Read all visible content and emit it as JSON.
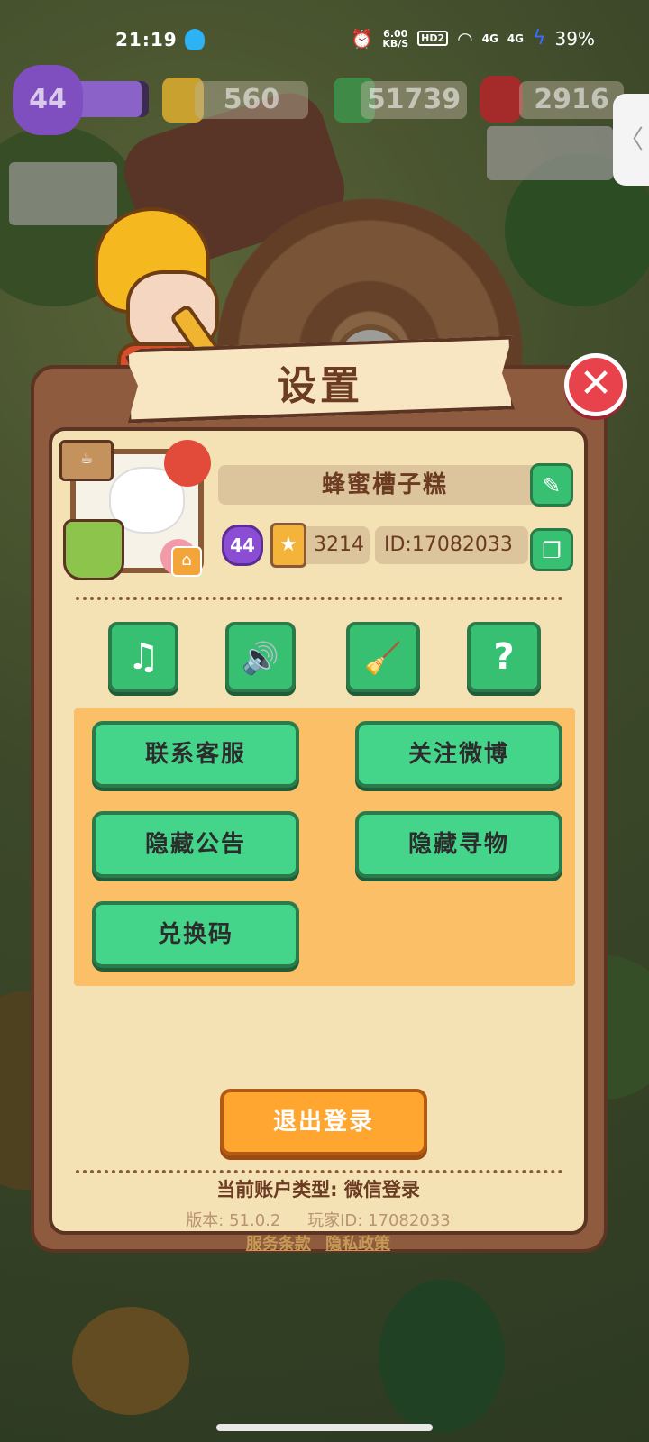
{
  "status_bar": {
    "time": "21:19",
    "net_speed": "6.00",
    "net_unit": "KB/S",
    "hd": "HD2",
    "sig1": "4G",
    "sig2": "4G",
    "battery": "39%"
  },
  "resources": {
    "level": "44",
    "xp_fraction": 0.9,
    "energy": "560",
    "cash": "51739",
    "gems": "2916"
  },
  "side_tab": {
    "glyph": "〈"
  },
  "dialog": {
    "title": "设置",
    "close": "✕",
    "profile": {
      "nickname": "蜂蜜槽子糕",
      "level": "44",
      "stars": "3214",
      "player_id": "ID:17082033",
      "edit_glyph": "✎",
      "copy_glyph": "❐"
    },
    "icon_buttons": {
      "music": "♫",
      "sound": "🔊",
      "clean": "🧹",
      "help": "?"
    },
    "menu": {
      "contact_support": "联系客服",
      "follow_weibo": "关注微博",
      "hide_notice": "隐藏公告",
      "hide_search": "隐藏寻物",
      "redeem_code": "兑换码"
    },
    "logout": "退出登录",
    "footer": {
      "account_type": "当前账户类型: 微信登录",
      "version": "版本: 51.0.2",
      "player_id": "玩家ID: 17082033",
      "terms": "服务条款",
      "privacy": "隐私政策"
    }
  },
  "colors": {
    "green_button": "#45d58a",
    "orange_button": "#ffa630",
    "dialog_brown": "#8e5b3e",
    "panel_cream": "#f4e1b4",
    "close_red": "#e8434d"
  }
}
